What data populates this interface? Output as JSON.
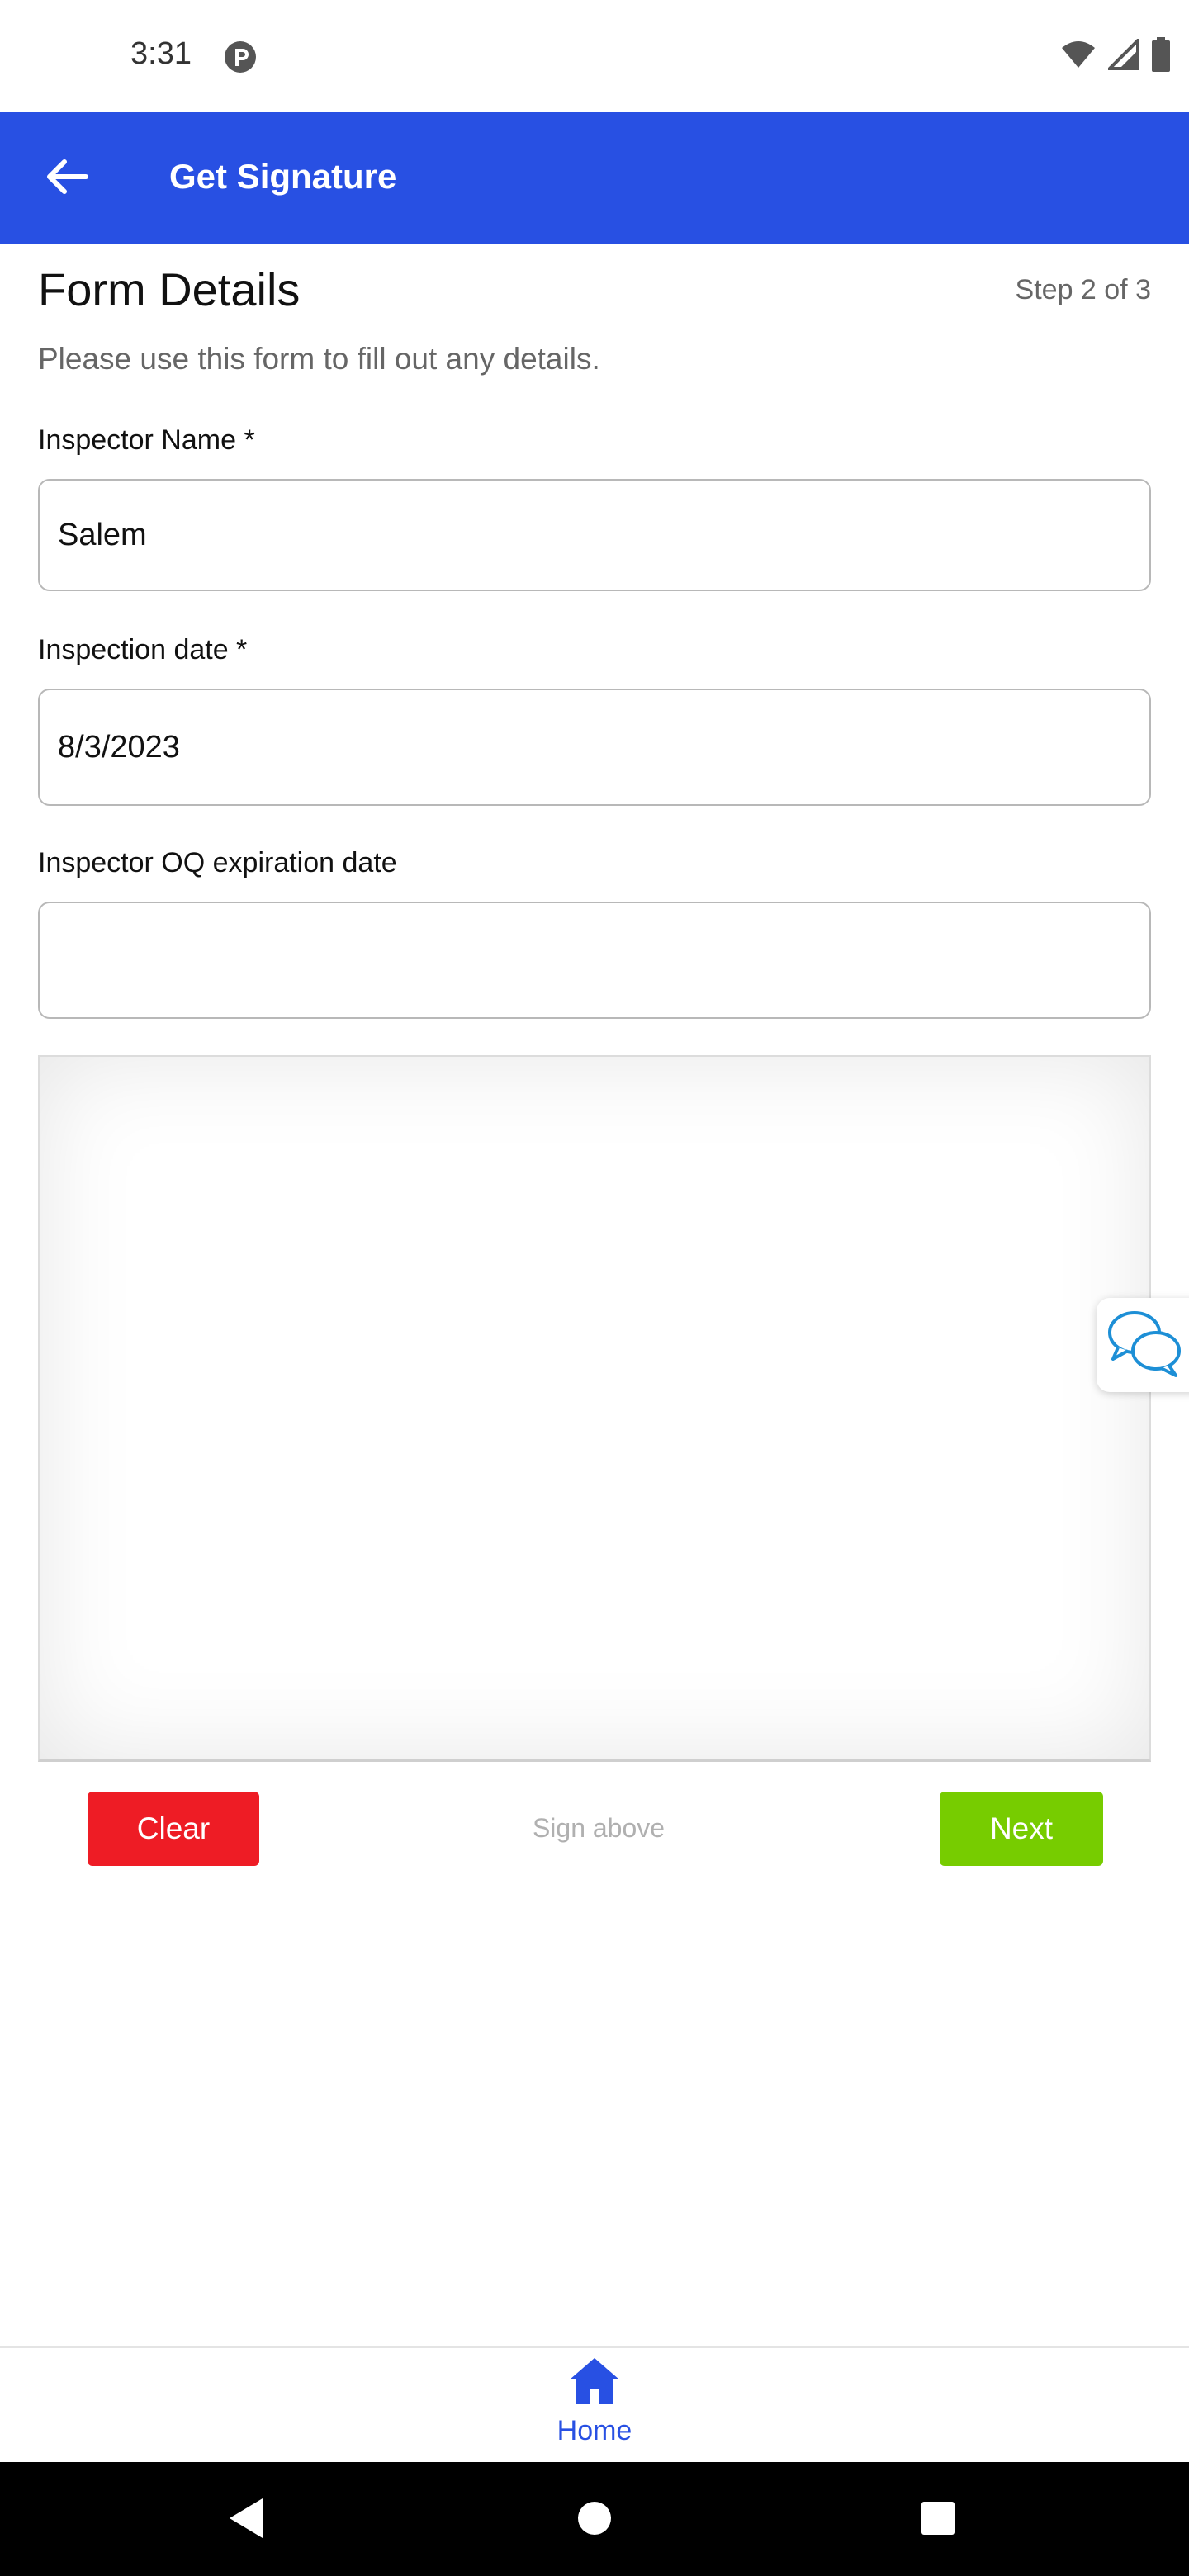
{
  "status_bar": {
    "time": "3:31",
    "icons": [
      "app-notification-icon",
      "wifi-icon",
      "cellular-signal-icon",
      "battery-icon"
    ]
  },
  "app_bar": {
    "title": "Get Signature",
    "back_icon": "arrow-left-icon",
    "background_color": "#2850e3"
  },
  "form": {
    "title": "Form Details",
    "step": "Step 2 of 3",
    "description": "Please use this form to fill out any details.",
    "fields": [
      {
        "label": "Inspector Name *",
        "value": "Salem",
        "placeholder": ""
      },
      {
        "label": "Inspection date *",
        "value": "8/3/2023",
        "placeholder": ""
      },
      {
        "label": "Inspector OQ expiration date",
        "value": "",
        "placeholder": ""
      }
    ]
  },
  "signature": {
    "clear_label": "Clear",
    "hint": "Sign above",
    "next_label": "Next",
    "clear_color": "#ee1c25",
    "next_color": "#77cc00"
  },
  "chat": {
    "icon": "chat-bubbles-icon"
  },
  "bottom_nav": {
    "items": [
      {
        "label": "Home",
        "icon": "home-icon",
        "active": true
      }
    ]
  },
  "system_nav": {
    "icons": [
      "back-triangle-icon",
      "home-circle-icon",
      "recents-square-icon"
    ]
  }
}
